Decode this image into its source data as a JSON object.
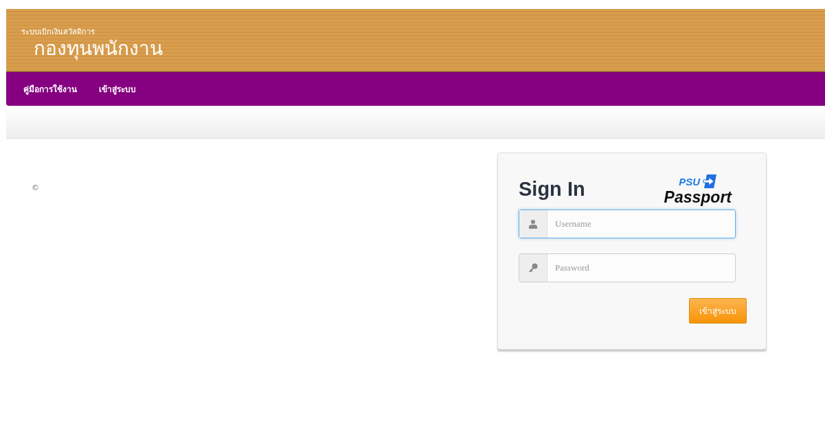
{
  "header": {
    "subtitle": "ระบบเบิกเงินสวัสดิการ",
    "title": "กองทุนพนักงาน"
  },
  "nav": {
    "items": [
      {
        "label": "คู่มือการใช้งาน"
      },
      {
        "label": "เข้าสู่ระบบ"
      }
    ]
  },
  "footer": {
    "copyright": "©"
  },
  "login": {
    "title": "Sign In",
    "logo": {
      "top": "PSU",
      "bottom": "Passport"
    },
    "fields": [
      {
        "kind": "user",
        "placeholder": "Username",
        "focused": true
      },
      {
        "kind": "password",
        "placeholder": "Password",
        "focused": false
      }
    ],
    "submit": "เข้าสู่ระบบ"
  }
}
